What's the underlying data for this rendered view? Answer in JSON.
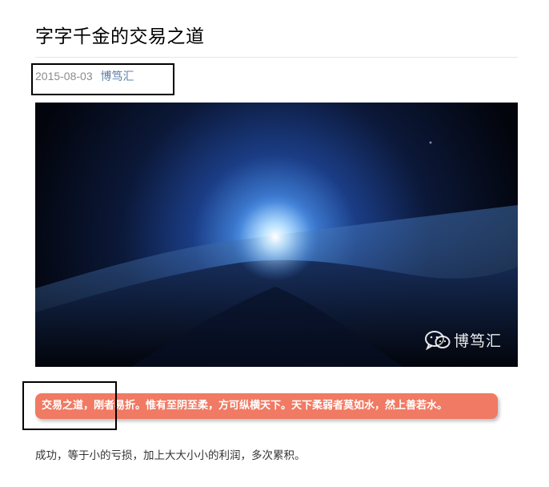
{
  "article": {
    "title": "字字千金的交易之道",
    "date": "2015-08-03",
    "author": "博笃汇"
  },
  "hero_image": {
    "watermark_icon": "wechat-icon",
    "watermark_text": "博笃汇"
  },
  "quote": {
    "text": "交易之道，刚者易折。惟有至阴至柔，方可纵横天下。天下柔弱者莫如水，然上善若水。",
    "background_color": "#f07a63"
  },
  "body": {
    "paragraph_1": "成功，等于小的亏损，加上大大小小的利润，多次累积。"
  },
  "colors": {
    "author_link": "#607fa6",
    "meta_text": "#8c8c8c"
  }
}
